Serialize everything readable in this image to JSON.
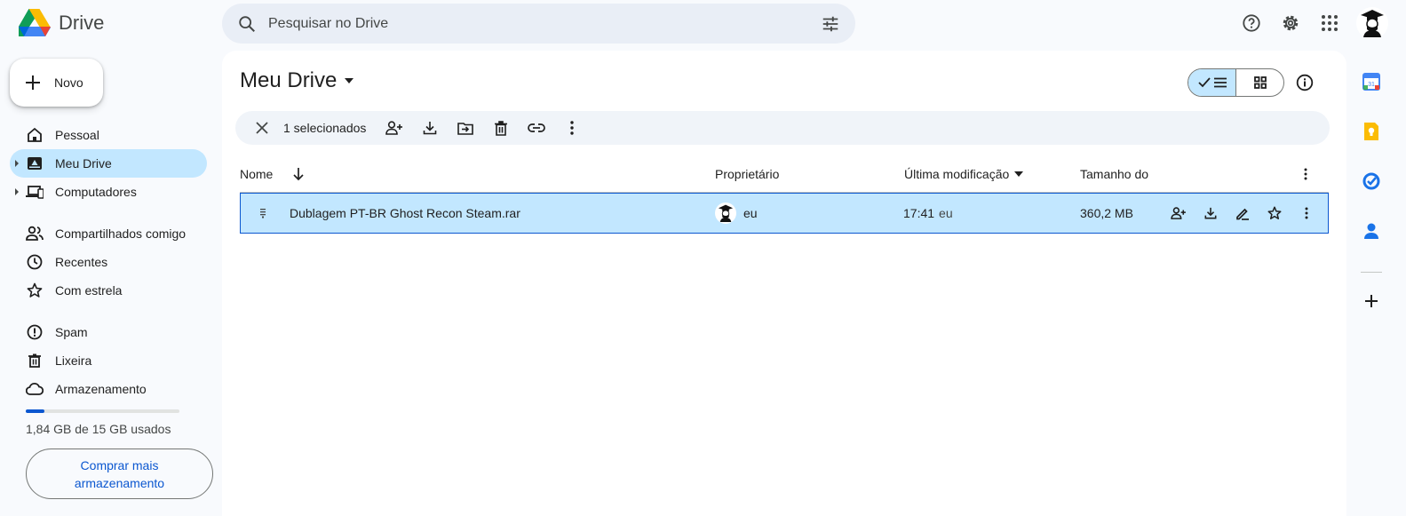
{
  "app": {
    "name": "Drive"
  },
  "search": {
    "placeholder": "Pesquisar no Drive"
  },
  "sidebar": {
    "new_label": "Novo",
    "items": [
      {
        "label": "Pessoal",
        "icon": "home-icon"
      },
      {
        "label": "Meu Drive",
        "icon": "my-drive-icon",
        "active": true
      },
      {
        "label": "Computadores",
        "icon": "computers-icon"
      },
      {
        "label": "Compartilhados comigo",
        "icon": "shared-icon"
      },
      {
        "label": "Recentes",
        "icon": "clock-icon"
      },
      {
        "label": "Com estrela",
        "icon": "star-icon"
      },
      {
        "label": "Spam",
        "icon": "spam-icon"
      },
      {
        "label": "Lixeira",
        "icon": "trash-icon"
      },
      {
        "label": "Armazenamento",
        "icon": "cloud-icon"
      }
    ],
    "storage": {
      "used_text": "1,84 GB de 15 GB usados",
      "used_fraction": 0.123
    },
    "buy_label": "Comprar mais armazenamento"
  },
  "main": {
    "title": "Meu Drive",
    "selection": {
      "count_label": "1 selecionados"
    },
    "columns": {
      "name": "Nome",
      "owner": "Proprietário",
      "modified": "Última modificação",
      "size": "Tamanho do"
    },
    "rows": [
      {
        "name": "Dublagem PT-BR Ghost Recon Steam.rar",
        "owner": "eu",
        "modified": "17:41",
        "modified_by": "eu",
        "size": "360,2 MB",
        "selected": true
      }
    ]
  },
  "colors": {
    "accent": "#0b57d0",
    "selected": "#c2e7ff",
    "background": "#f8fafd",
    "surface": "#ffffff"
  }
}
